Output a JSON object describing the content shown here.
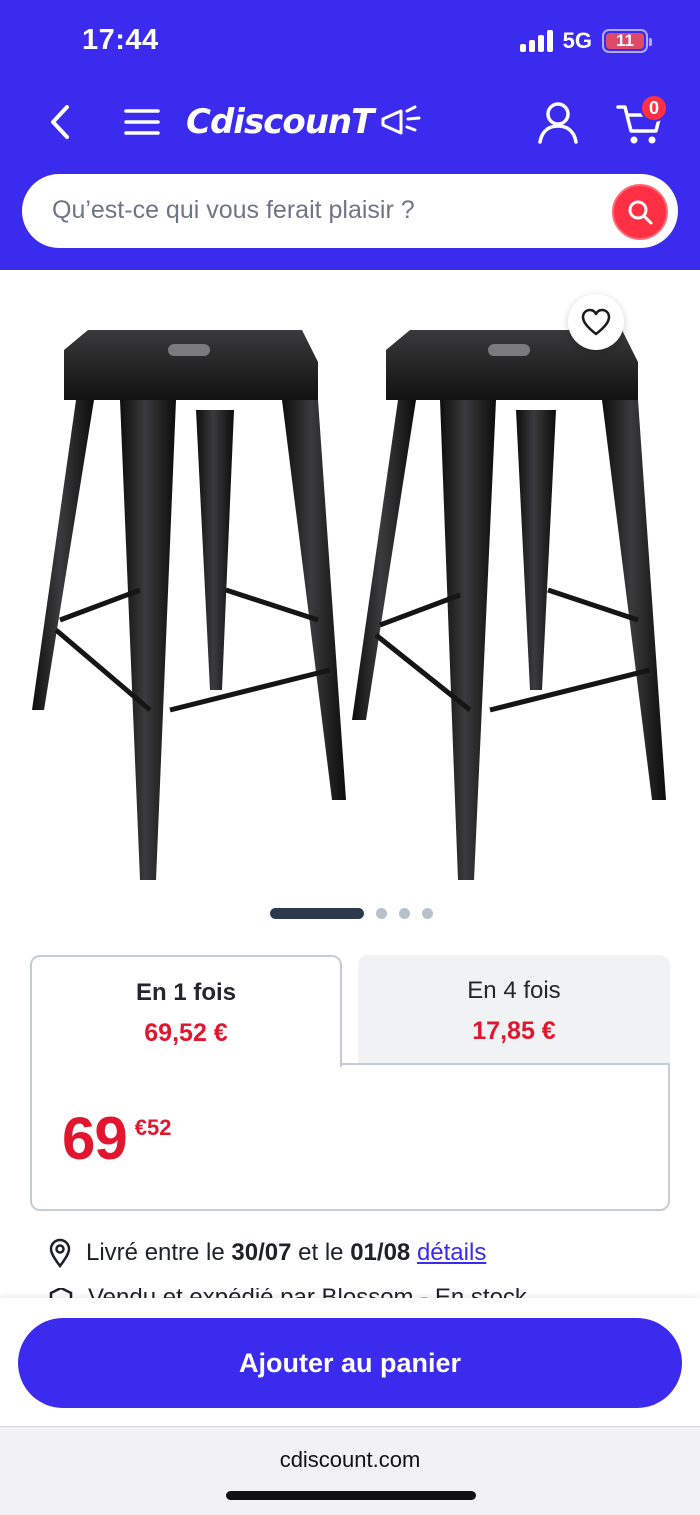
{
  "status_bar": {
    "time": "17:44",
    "network": "5G",
    "battery": "11"
  },
  "header": {
    "logo": "CdiscounT",
    "cart_count": "0",
    "search_placeholder": "Qu’est-ce qui vous ferait plaisir ?"
  },
  "carousel": {
    "total_images": 4,
    "active_index": 0
  },
  "payment": {
    "tabs": [
      {
        "title": "En 1 fois",
        "price": "69,52 €"
      },
      {
        "title": "En 4 fois",
        "price": "17,85 €"
      }
    ],
    "price_integer": "69",
    "price_decimal": "€52"
  },
  "delivery": {
    "prefix": "Livré entre le",
    "date_from": "30/07",
    "middle": "et le",
    "date_to": "01/08",
    "link": "détails"
  },
  "seller": {
    "text": "Vendu et expédié par Blossom - En stock"
  },
  "actions": {
    "add_to_cart": "Ajouter au panier"
  },
  "browser": {
    "url": "cdiscount.com"
  },
  "colors": {
    "brand": "#3a2bee",
    "price": "#e3162f",
    "accent": "#ff3043"
  }
}
